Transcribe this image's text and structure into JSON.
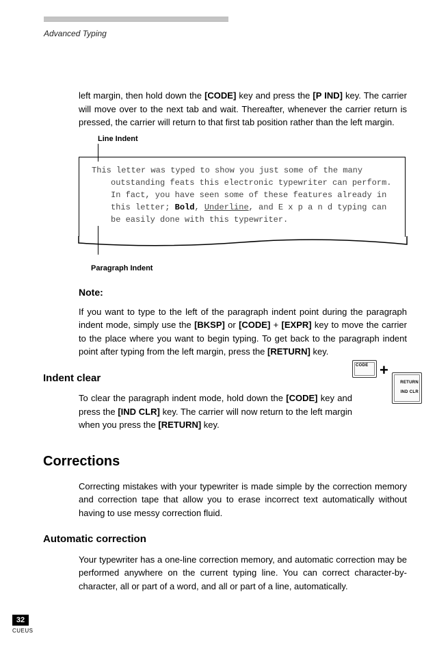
{
  "running_head": "Advanced Typing",
  "intro_para_a": "left margin, then hold down the ",
  "intro_key1": "[CODE]",
  "intro_para_b": " key and press the ",
  "intro_key2": "[P IND]",
  "intro_para_c": " key. The carrier will move over to the next tab and wait. Thereafter, whenever the carrier return is pressed, the carrier will return to that first tab position rather than the left margin.",
  "line_indent_label": "Line Indent",
  "sample": {
    "l1": "This letter was typed to show you just some of the many outstanding feats this electronic typewriter can perform.",
    "l2a": "In fact, you have seen some of these features already in this letter; ",
    "l2_bold": "Bold",
    "l2b": ", ",
    "l2_under": "Underline",
    "l2c": ", and E x p a n d typing can be easily done with this typewriter."
  },
  "paragraph_indent_label": "Paragraph Indent",
  "note_label": "Note:",
  "note_a": "If you want to type to the left of the paragraph indent point during the paragraph indent mode, simply use the ",
  "note_k1": "[BKSP]",
  "note_b": " or ",
  "note_k2": "[CODE]",
  "note_c": " + ",
  "note_k3": "[EXPR]",
  "note_d": " key to move the carrier to the place where you want to begin typing. To get back to the paragraph indent point after typing from the left margin, press the ",
  "note_k4": "[RETURN]",
  "note_e": " key.",
  "indent_clear_h": "Indent clear",
  "ic_a": "To clear the paragraph indent mode, hold down the ",
  "ic_k1": "[CODE]",
  "ic_b": " key and press the ",
  "ic_k2": "[IND CLR]",
  "ic_c": " key. The carrier will now return to the left margin when you press the ",
  "ic_k3": "[RETURN]",
  "ic_d": " key.",
  "corrections_h": "Corrections",
  "corr_para": "Correcting mistakes with your typewriter is made simple by the correction memory and correction tape that allow you to erase incorrect text automatically without having to use messy correction fluid.",
  "auto_h": "Automatic correction",
  "auto_para": "Your typewriter has a one-line correction memory, and automatic correction may be performed anywhere on the current typing line. You can correct character-by-character, all or part of a word, and all or part of a line, automatically.",
  "kbd": {
    "code": "CODE",
    "return": "RETURN",
    "indclr": "IND CLR",
    "plus": "+"
  },
  "page_number": "32",
  "footer_code": "CUEUS"
}
